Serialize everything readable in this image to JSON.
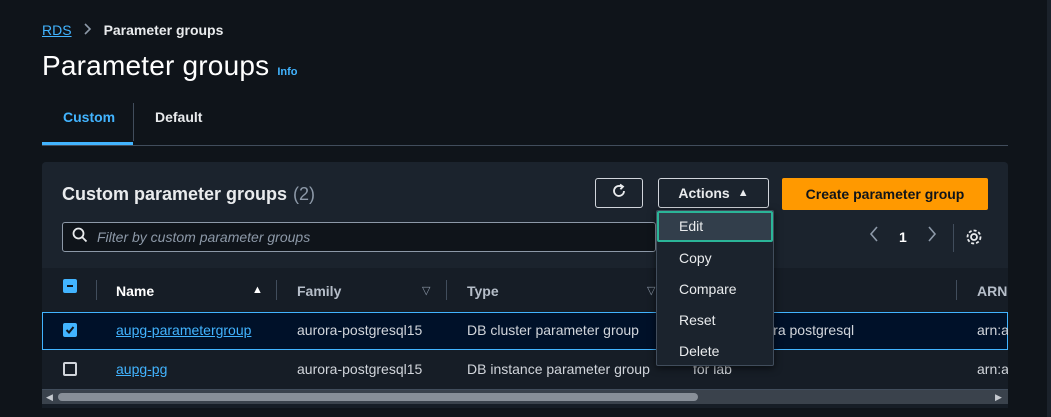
{
  "breadcrumb": {
    "root": "RDS",
    "current": "Parameter groups"
  },
  "page": {
    "title": "Parameter groups",
    "info": "Info"
  },
  "tabs": [
    {
      "label": "Custom",
      "active": true
    },
    {
      "label": "Default",
      "active": false
    }
  ],
  "panel": {
    "title": "Custom parameter groups",
    "count": "(2)",
    "actions_label": "Actions",
    "create_label": "Create parameter group",
    "search_placeholder": "Filter by custom parameter groups",
    "page_number": "1"
  },
  "table": {
    "columns": [
      "Name",
      "Family",
      "Type",
      "ARN"
    ],
    "rows": [
      {
        "name": "aupg-parametergroup",
        "family": "aurora-postgresql15",
        "type": "DB cluster parameter group",
        "description": "roup for aurora postgresql",
        "arn": "arn:a",
        "selected": true
      },
      {
        "name": "aupg-pg",
        "family": "aurora-postgresql15",
        "type": "DB instance parameter group",
        "description": "for lab",
        "arn": "arn:a",
        "selected": false
      }
    ]
  },
  "actions_menu": [
    "Edit",
    "Copy",
    "Compare",
    "Reset",
    "Delete"
  ],
  "colors": {
    "accent": "#42b4ff",
    "primary_button": "#ff9900",
    "background": "#0f141a",
    "focus_ring": "#2bb598"
  },
  "icons": [
    "chevron-right-icon",
    "refresh-icon",
    "caret-up-icon",
    "search-icon",
    "chevron-left-icon",
    "settings-icon",
    "sort-ascending-icon",
    "sort-icon",
    "checkmark-icon"
  ]
}
